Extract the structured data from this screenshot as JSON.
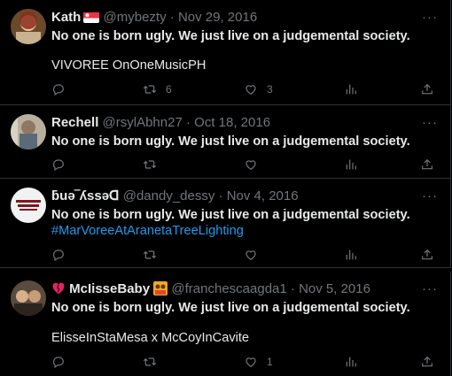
{
  "tweets": [
    {
      "name": "Kath",
      "handle": "@mybezty",
      "date": "Nov 29, 2016",
      "line1": "No one is born ugly. We just live on a judgemental society.",
      "line2": "VIVOREE OnOneMusicPH",
      "replies": "",
      "retweets": "6",
      "likes": "3"
    },
    {
      "name": "Rechell",
      "handle": "@rsylAbhn27",
      "date": "Oct 18, 2016",
      "line1": "No one is born ugly. We just live on a judgemental society.",
      "retweets": "",
      "likes": ""
    },
    {
      "name": "ƃuǝ‾ʎssǝᗡ",
      "handle": "@dandy_dessy",
      "date": "Nov 4, 2016",
      "line1": "No one is born ugly. We just live on a judgemental society.",
      "hashtag": "#MarVoreeAtAranetaTreeLighting",
      "retweets": "",
      "likes": ""
    },
    {
      "name": "McIisseBaby",
      "handle": "@franchescaagda1",
      "date": "Nov 5, 2016",
      "line1": "No one is born ugly. We just live on a judgemental society.",
      "line2": "ElisseInStaMesa x McCoyInCavite",
      "retweets": "",
      "likes": "1"
    }
  ],
  "separator": "·",
  "more_icon": "···",
  "colors": {
    "background": "#000000",
    "text": "#e7e9ea",
    "muted": "#71767b",
    "link": "#1d9bf0",
    "divider": "#2f3336"
  },
  "icons": [
    "reply-icon",
    "retweet-icon",
    "like-icon",
    "views-icon",
    "share-icon"
  ]
}
